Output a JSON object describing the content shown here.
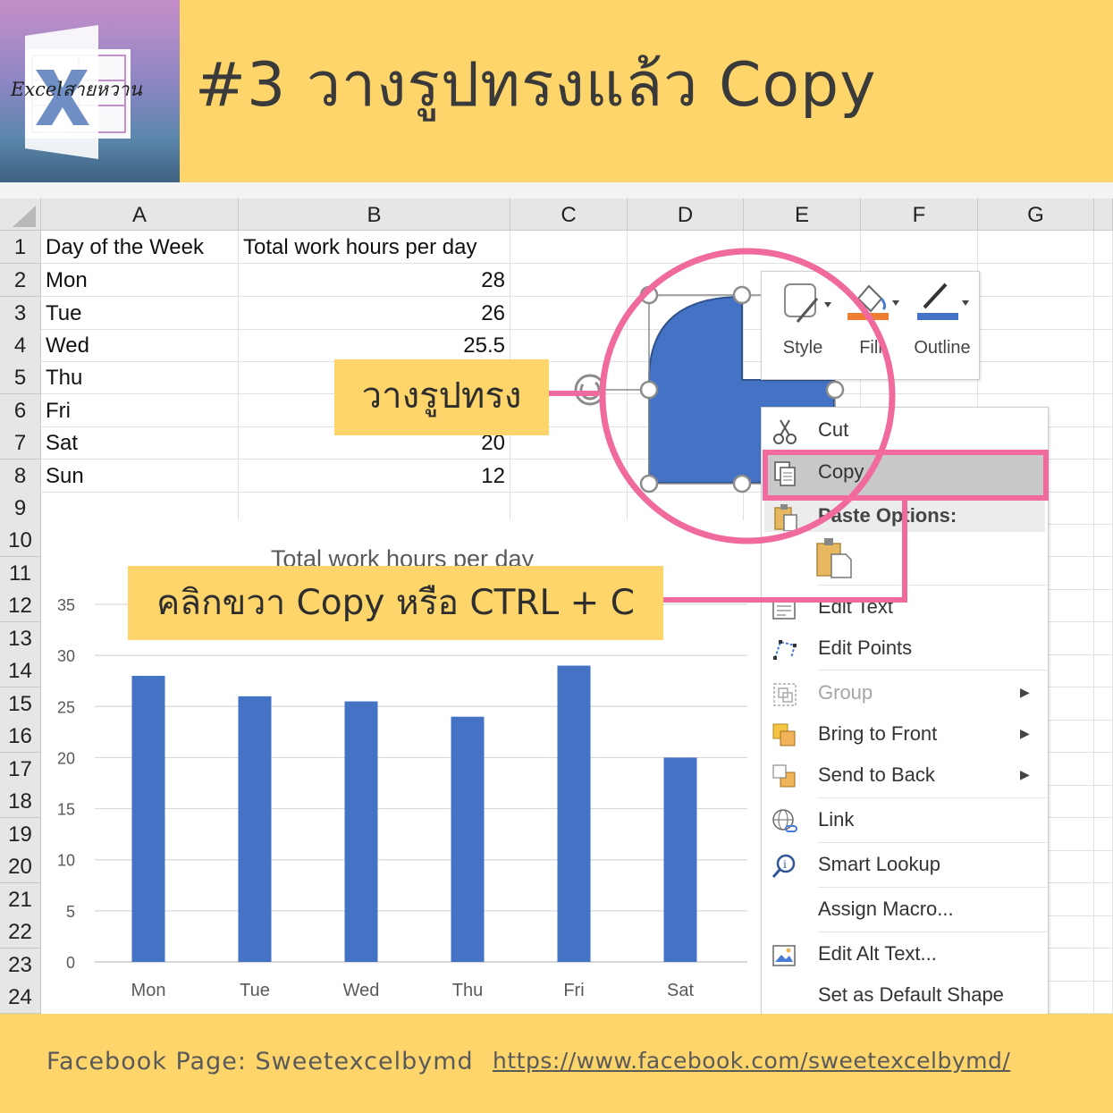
{
  "header": {
    "logo_text": "Excelสายหวาน",
    "title": "#3 วางรูปทรงแล้ว Copy"
  },
  "sheet": {
    "columns": [
      "A",
      "B",
      "C",
      "D",
      "E",
      "F",
      "G"
    ],
    "rows": [
      "1",
      "2",
      "3",
      "4",
      "5",
      "6",
      "7",
      "8",
      "9",
      "10",
      "11",
      "12",
      "13",
      "14",
      "15",
      "16",
      "17",
      "18",
      "19",
      "20",
      "21",
      "22",
      "23",
      "24"
    ],
    "cells": {
      "a1": "Day of the Week",
      "b1": "Total work hours per day",
      "a2": "Mon",
      "b2": "28",
      "a3": "Tue",
      "b3": "26",
      "a4": "Wed",
      "b4": "25.5",
      "a5": "Thu",
      "a6": "Fri",
      "a7": "Sat",
      "b7": "20",
      "a8": "Sun",
      "b8": "12"
    }
  },
  "chart_data": {
    "type": "bar",
    "title": "Total work hours per day",
    "categories": [
      "Mon",
      "Tue",
      "Wed",
      "Thu",
      "Fri",
      "Sat"
    ],
    "values": [
      28,
      26,
      25.5,
      24,
      29,
      20
    ],
    "ylim": [
      0,
      35
    ],
    "yticks": [
      0,
      5,
      10,
      15,
      20,
      25,
      30,
      35
    ],
    "bar_color": "#4472c4",
    "grid": true
  },
  "callouts": {
    "shape": "วางรูปทรง",
    "copy": "คลิกขวา Copy หรือ CTRL + C"
  },
  "toolbar": {
    "style_label": "Style",
    "fill_label": "Fill",
    "outline_label": "Outline"
  },
  "menu": {
    "cut": "Cut",
    "copy": "Copy",
    "paste_options": "Paste Options:",
    "edit_text": "Edit Text",
    "edit_points": "Edit Points",
    "group": "Group",
    "bring_to_front": "Bring to Front",
    "send_to_back": "Send to Back",
    "link": "Link",
    "smart_lookup": "Smart Lookup",
    "assign_macro": "Assign Macro...",
    "edit_alt_text": "Edit Alt Text...",
    "set_default_shape": "Set as Default Shape"
  },
  "footer": {
    "label": "Facebook Page: Sweetexcelbymd",
    "link": "https://www.facebook.com/sweetexcelbymd/"
  },
  "colors": {
    "accent_yellow": "#fdd56a",
    "highlight_pink": "#f06a9e",
    "shape_blue": "#4472c4"
  }
}
